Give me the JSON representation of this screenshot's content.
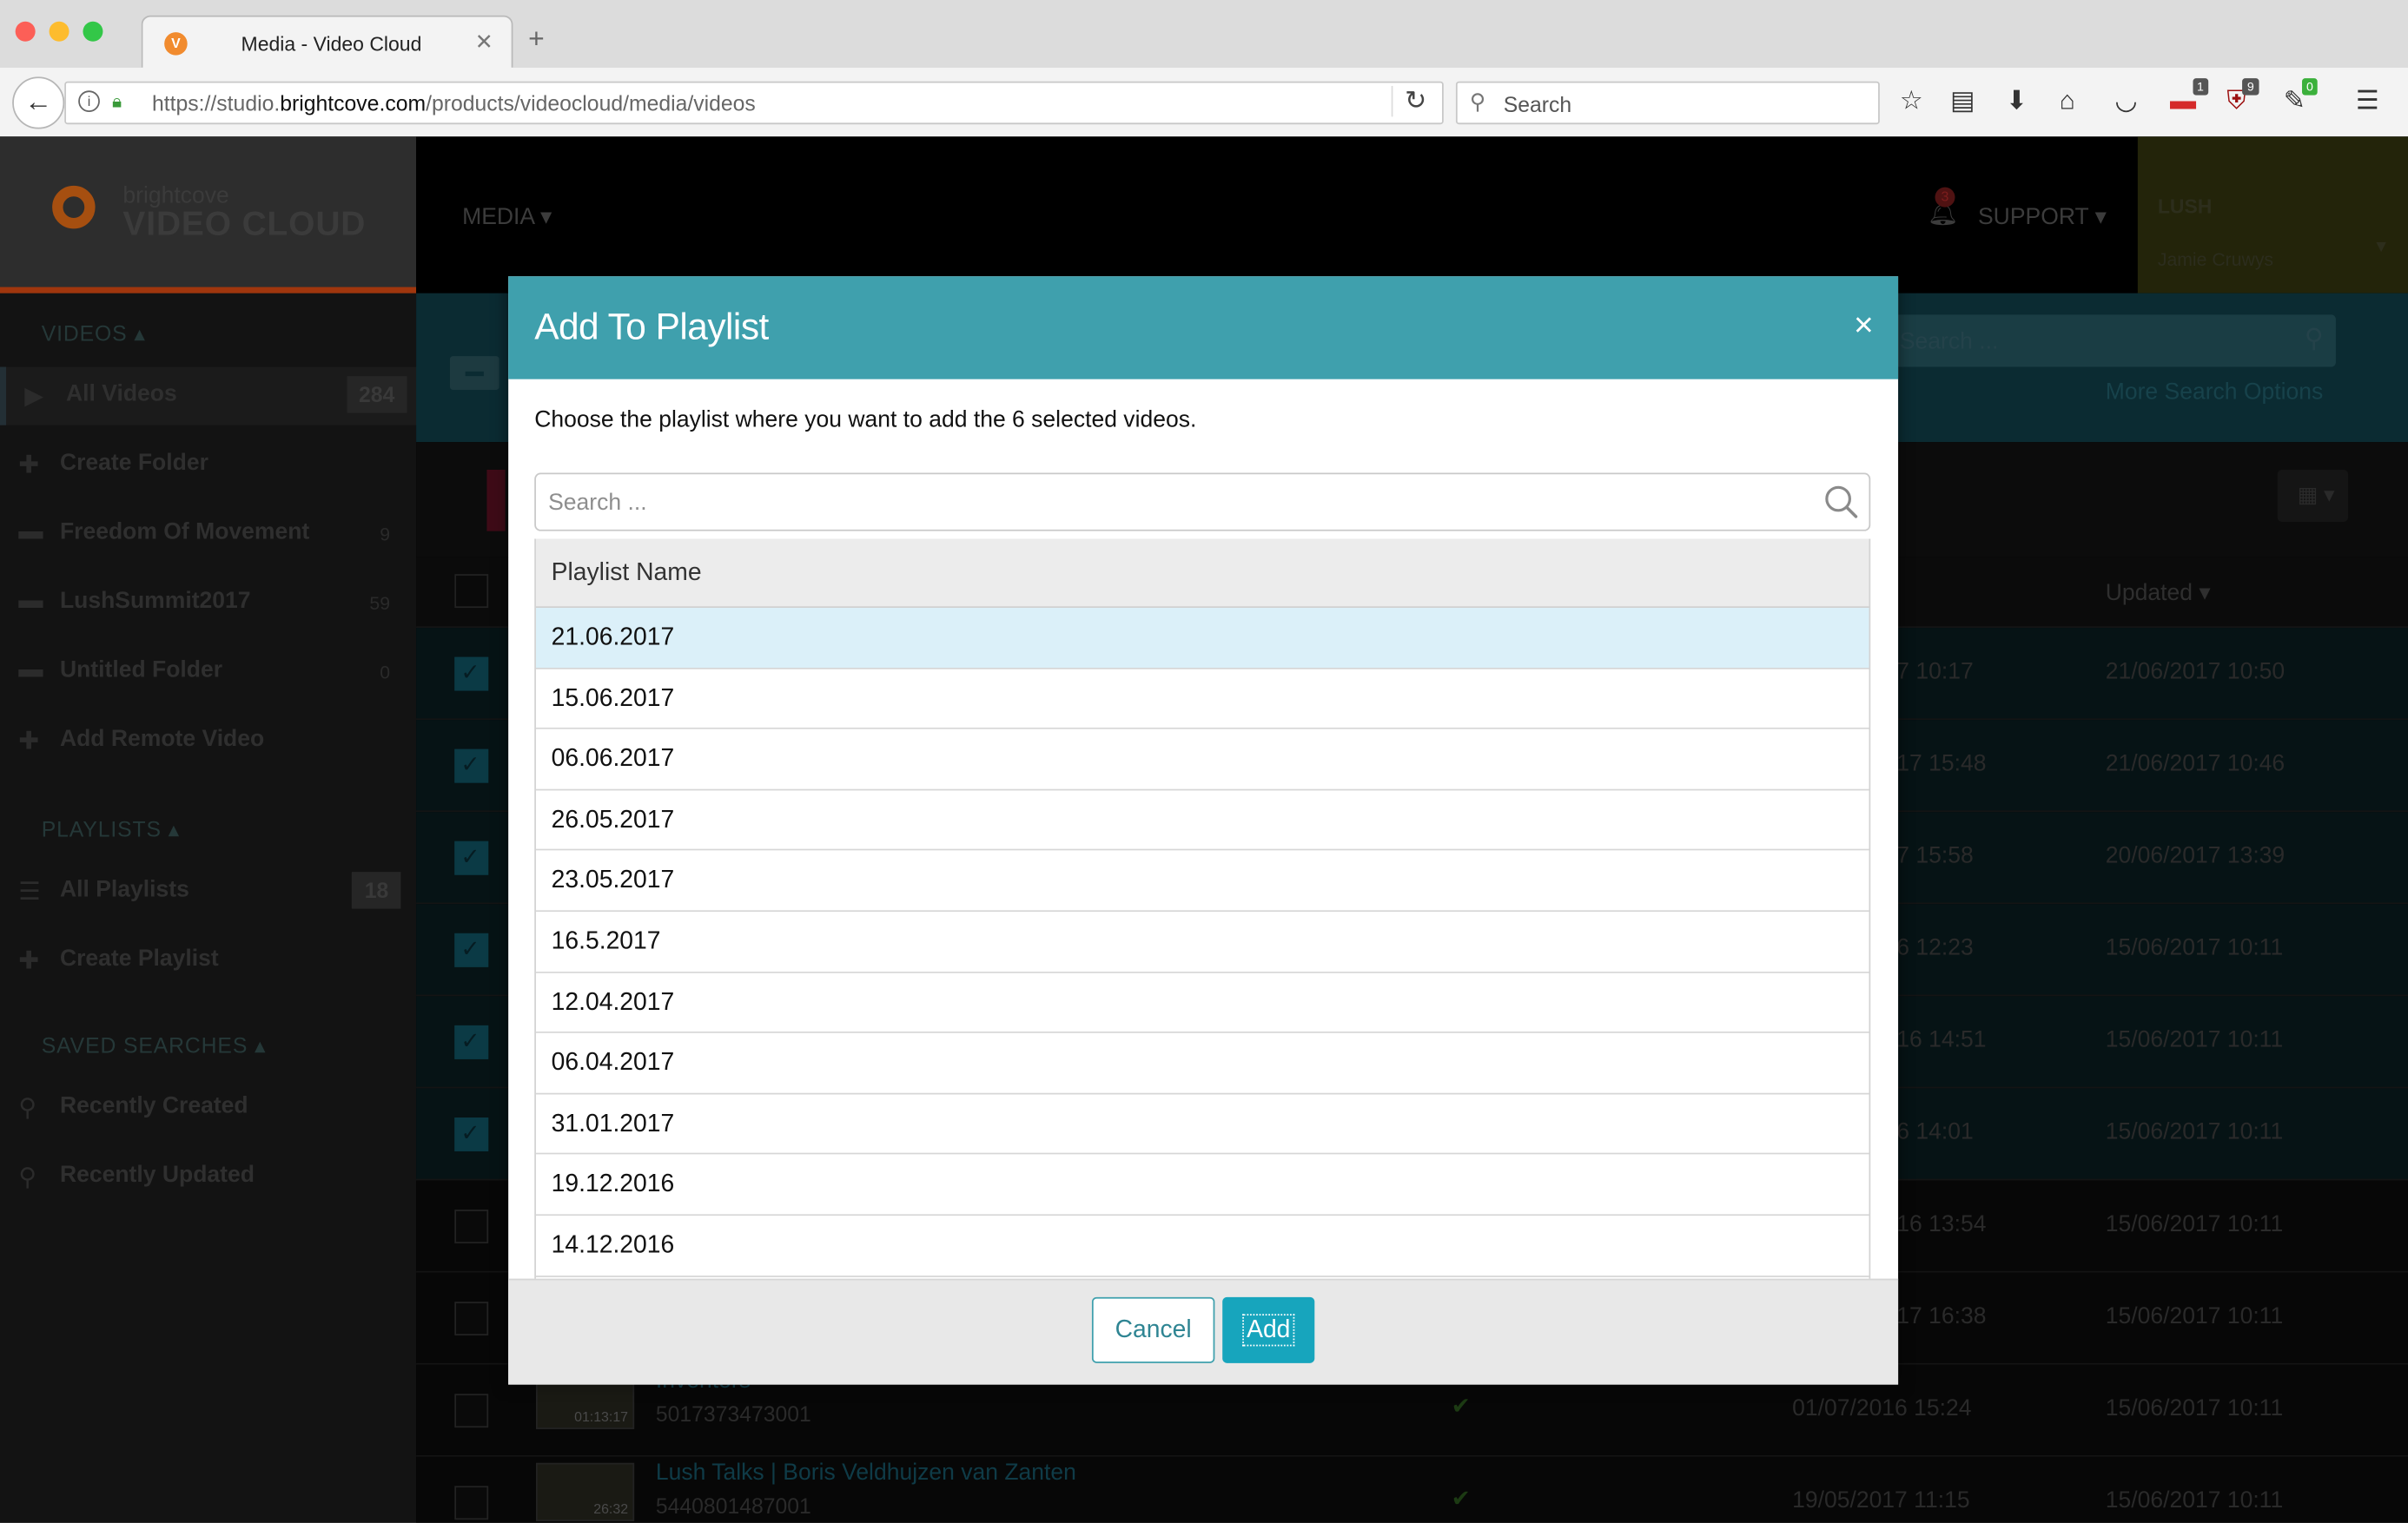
{
  "browser": {
    "tab_title": "Media - Video Cloud",
    "tab_favicon": "V",
    "url_prefix": "https://studio.",
    "url_domain": "brightcove.com",
    "url_path": "/products/videocloud/media/videos",
    "search_placeholder": "Search",
    "badges": {
      "ext1": "1",
      "ublock": "9",
      "ext3": "0"
    }
  },
  "app": {
    "logo_small": "brightcove",
    "logo_big": "VIDEO CLOUD",
    "nav_media": "MEDIA ▾",
    "nav_support": "SUPPORT ▾",
    "notif_count": "3",
    "account_name": "LUSH",
    "account_user": "Jamie Cruwys",
    "search_placeholder": "Search ...",
    "more_search": "More Search Options",
    "updated_header": "Updated ▾"
  },
  "sidebar": {
    "videos_header": "VIDEOS ▴",
    "playlists_header": "PLAYLISTS ▴",
    "saved_header": "SAVED SEARCHES ▴",
    "items": [
      {
        "label": "All Videos",
        "count": "284"
      },
      {
        "label": "Create Folder",
        "count": ""
      },
      {
        "label": "Freedom Of Movement",
        "count": "9"
      },
      {
        "label": "LushSummit2017",
        "count": "59"
      },
      {
        "label": "Untitled Folder",
        "count": "0"
      },
      {
        "label": "Add Remote Video",
        "count": ""
      },
      {
        "label": "All Playlists",
        "count": "18"
      },
      {
        "label": "Create Playlist",
        "count": ""
      },
      {
        "label": "Recently Created",
        "count": ""
      },
      {
        "label": "Recently Updated",
        "count": ""
      }
    ]
  },
  "videos": [
    {
      "created": "7 10:17",
      "updated": "21/06/2017 10:50"
    },
    {
      "created": "17 15:48",
      "updated": "21/06/2017 10:46"
    },
    {
      "created": "7 15:58",
      "updated": "20/06/2017 13:39"
    },
    {
      "created": "6 12:23",
      "updated": "15/06/2017 10:11"
    },
    {
      "created": "16 14:51",
      "updated": "15/06/2017 10:11"
    },
    {
      "created": "6 14:01",
      "updated": "15/06/2017 10:11"
    },
    {
      "created": "16 13:54",
      "updated": "15/06/2017 10:11"
    },
    {
      "created": "17 16:38",
      "updated": "15/06/2017 10:11"
    },
    {
      "name": "Inventors",
      "id": "5017373473001",
      "duration": "01:13:17",
      "created": "01/07/2016 15:24",
      "updated": "15/06/2017 10:11"
    },
    {
      "name": "Lush Talks | Boris Veldhujzen van Zanten",
      "id": "5440801487001",
      "duration": "26:32",
      "created": "19/05/2017 11:15",
      "updated": "15/06/2017 10:11"
    }
  ],
  "modal": {
    "title": "Add To Playlist",
    "close_symbol": "×",
    "description": "Choose the playlist where you want to add the 6 selected videos.",
    "search_placeholder": "Search ...",
    "column_header": "Playlist Name",
    "playlists": [
      "21.06.2017",
      "15.06.2017",
      "06.06.2017",
      "26.05.2017",
      "23.05.2017",
      "16.5.2017",
      "12.04.2017",
      "06.04.2017",
      "31.01.2017",
      "19.12.2016",
      "14.12.2016"
    ],
    "cancel_label": "Cancel",
    "add_label": "Add"
  },
  "colors": {
    "modal_header": "#3fa0ad",
    "add_button": "#17a5bd",
    "selected_row": "#dbf0f9"
  }
}
